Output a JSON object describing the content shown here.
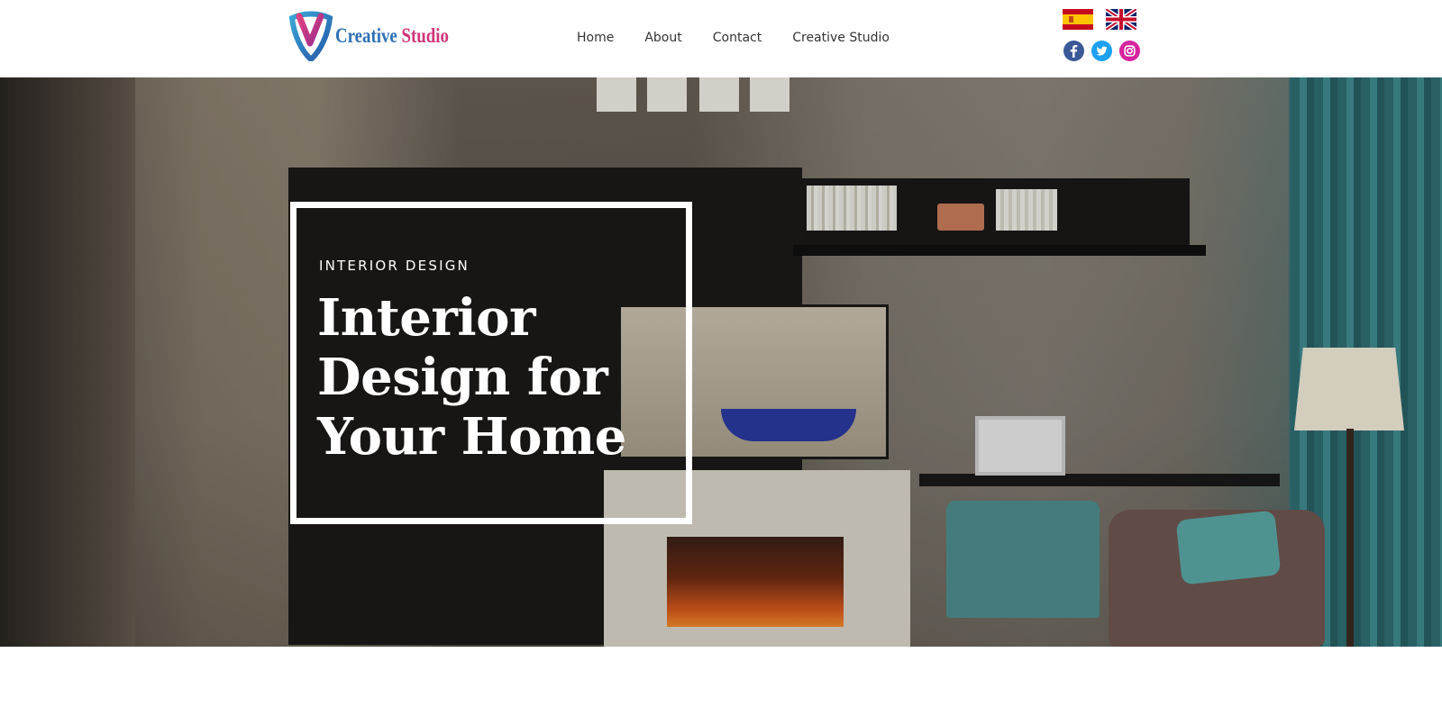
{
  "brand": {
    "word1": "Creative",
    "word2": "Studio",
    "colors": {
      "blue": "#2d6fb7",
      "pink": "#d0357a"
    }
  },
  "nav": {
    "items": [
      "Home",
      "About",
      "Contact",
      "Creative Studio"
    ]
  },
  "languages": [
    {
      "name": "spanish-flag-icon"
    },
    {
      "name": "uk-flag-icon"
    }
  ],
  "social": [
    {
      "name": "facebook-icon",
      "color": "#3b5998"
    },
    {
      "name": "twitter-icon",
      "color": "#1da1f2"
    },
    {
      "name": "instagram-icon",
      "color": "#d6249f"
    }
  ],
  "hero": {
    "kicker": "INTERIOR DESIGN",
    "headline_lines": [
      "Interior",
      "Design for",
      "Your Home"
    ]
  }
}
